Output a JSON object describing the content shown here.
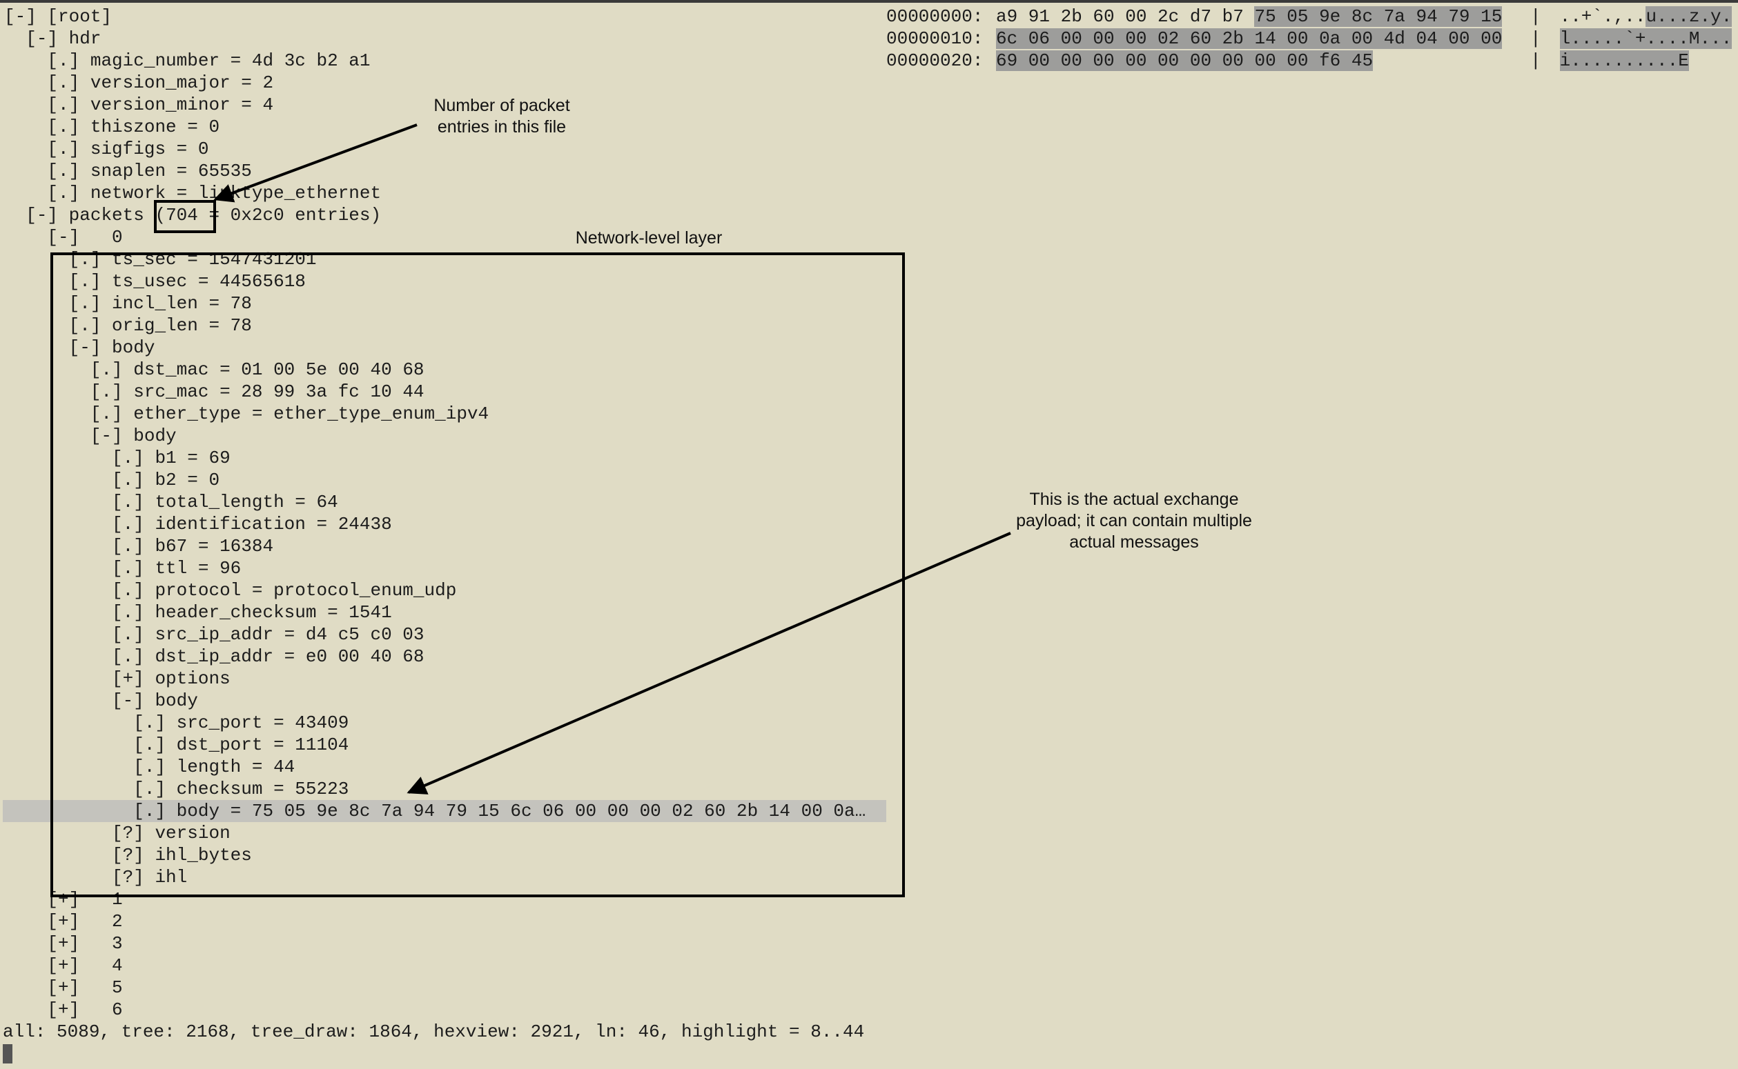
{
  "tree": [
    {
      "indent": 0,
      "marker": "[-]",
      "text": "[root]"
    },
    {
      "indent": 1,
      "marker": "[-]",
      "text": "hdr"
    },
    {
      "indent": 2,
      "marker": "[.]",
      "text": "magic_number = 4d 3c b2 a1"
    },
    {
      "indent": 2,
      "marker": "[.]",
      "text": "version_major = 2"
    },
    {
      "indent": 2,
      "marker": "[.]",
      "text": "version_minor = 4"
    },
    {
      "indent": 2,
      "marker": "[.]",
      "text": "thiszone = 0"
    },
    {
      "indent": 2,
      "marker": "[.]",
      "text": "sigfigs = 0"
    },
    {
      "indent": 2,
      "marker": "[.]",
      "text": "snaplen = 65535"
    },
    {
      "indent": 2,
      "marker": "[.]",
      "text": "network = linktype_ethernet"
    },
    {
      "indent": 1,
      "marker": "[-]",
      "text": "packets (704 = 0x2c0 entries)"
    },
    {
      "indent": 2,
      "marker": "[-]",
      "text": "  0"
    },
    {
      "indent": 3,
      "marker": "[.]",
      "text": "ts_sec = 1547431201"
    },
    {
      "indent": 3,
      "marker": "[.]",
      "text": "ts_usec = 44565618"
    },
    {
      "indent": 3,
      "marker": "[.]",
      "text": "incl_len = 78"
    },
    {
      "indent": 3,
      "marker": "[.]",
      "text": "orig_len = 78"
    },
    {
      "indent": 3,
      "marker": "[-]",
      "text": "body"
    },
    {
      "indent": 4,
      "marker": "[.]",
      "text": "dst_mac = 01 00 5e 00 40 68"
    },
    {
      "indent": 4,
      "marker": "[.]",
      "text": "src_mac = 28 99 3a fc 10 44"
    },
    {
      "indent": 4,
      "marker": "[.]",
      "text": "ether_type = ether_type_enum_ipv4"
    },
    {
      "indent": 4,
      "marker": "[-]",
      "text": "body"
    },
    {
      "indent": 5,
      "marker": "[.]",
      "text": "b1 = 69"
    },
    {
      "indent": 5,
      "marker": "[.]",
      "text": "b2 = 0"
    },
    {
      "indent": 5,
      "marker": "[.]",
      "text": "total_length = 64"
    },
    {
      "indent": 5,
      "marker": "[.]",
      "text": "identification = 24438"
    },
    {
      "indent": 5,
      "marker": "[.]",
      "text": "b67 = 16384"
    },
    {
      "indent": 5,
      "marker": "[.]",
      "text": "ttl = 96"
    },
    {
      "indent": 5,
      "marker": "[.]",
      "text": "protocol = protocol_enum_udp"
    },
    {
      "indent": 5,
      "marker": "[.]",
      "text": "header_checksum = 1541"
    },
    {
      "indent": 5,
      "marker": "[.]",
      "text": "src_ip_addr = d4 c5 c0 03"
    },
    {
      "indent": 5,
      "marker": "[.]",
      "text": "dst_ip_addr = e0 00 40 68"
    },
    {
      "indent": 5,
      "marker": "[+]",
      "text": "options"
    },
    {
      "indent": 5,
      "marker": "[-]",
      "text": "body"
    },
    {
      "indent": 6,
      "marker": "[.]",
      "text": "src_port = 43409"
    },
    {
      "indent": 6,
      "marker": "[.]",
      "text": "dst_port = 11104"
    },
    {
      "indent": 6,
      "marker": "[.]",
      "text": "length = 44"
    },
    {
      "indent": 6,
      "marker": "[.]",
      "text": "checksum = 55223"
    },
    {
      "indent": 6,
      "marker": "[.]",
      "text": "body = 75 05 9e 8c 7a 94 79 15 6c 06 00 00 00 02 60 2b 14 00 0a…",
      "selected": true
    },
    {
      "indent": 5,
      "marker": "[?]",
      "text": "version"
    },
    {
      "indent": 5,
      "marker": "[?]",
      "text": "ihl_bytes"
    },
    {
      "indent": 5,
      "marker": "[?]",
      "text": "ihl"
    },
    {
      "indent": 2,
      "marker": "[+]",
      "text": "  1"
    },
    {
      "indent": 2,
      "marker": "[+]",
      "text": "  2"
    },
    {
      "indent": 2,
      "marker": "[+]",
      "text": "  3"
    },
    {
      "indent": 2,
      "marker": "[+]",
      "text": "  4"
    },
    {
      "indent": 2,
      "marker": "[+]",
      "text": "  5"
    },
    {
      "indent": 2,
      "marker": "[+]",
      "text": "  6"
    }
  ],
  "hexview": [
    {
      "offset": "00000000:",
      "plain_bytes": "a9 91 2b 60 00 2c d7 b7 ",
      "hl_bytes": "75 05 9e 8c 7a 94 79 15",
      "sep": "|",
      "plain_ascii": " ..+`.,..",
      "hl_ascii": "u...z.y."
    },
    {
      "offset": "00000010:",
      "plain_bytes": "",
      "hl_bytes": "6c 06 00 00 00 02 60 2b 14 00 0a 00 4d 04 00 00",
      "sep": "|",
      "plain_ascii": " ",
      "hl_ascii": "l.....`+....M..."
    },
    {
      "offset": "00000020:",
      "plain_bytes": "",
      "hl_bytes": "69 00 00 00 00 00 00 00 00 00 f6 45",
      "sep": "|",
      "plain_ascii": " ",
      "hl_ascii": "i..........E"
    }
  ],
  "status_line": "all: 5089, tree: 2168, tree_draw: 1864, hexview: 2921, ln: 46, highlight = 8..44",
  "annotations": {
    "packet_count_note": "Number of packet entries in this file",
    "network_layer_label": "Network-level layer",
    "payload_note": "This is the actual exchange payload; it can contain multiple actual messages"
  }
}
